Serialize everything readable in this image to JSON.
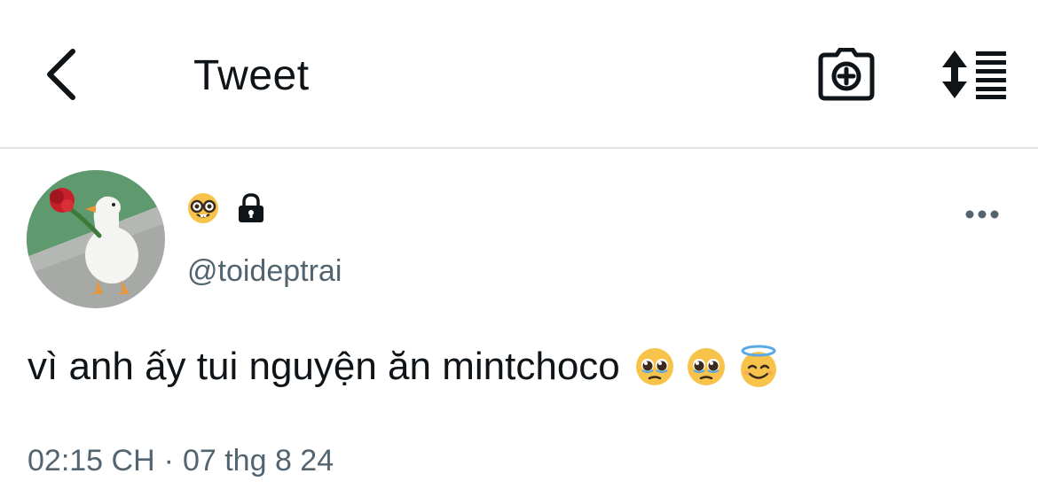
{
  "header": {
    "back_icon": "chevron-left-icon",
    "title": "Tweet",
    "camera_icon": "camera-plus-icon",
    "sort_icon": "sort-lines-icon"
  },
  "tweet": {
    "avatar_description_icon": "goose-with-rose-avatar",
    "name_emoji": "🤓",
    "lock_icon": "lock-icon",
    "handle": "@toideptrai",
    "more_icon": "more-dots-icon",
    "text": "vì anh ấy tui nguyện ăn mintchoco",
    "text_emojis": [
      "🥹",
      "🥹",
      "😇"
    ],
    "time": "02:15 CH",
    "separator": "·",
    "date": "07 thg 8 24"
  },
  "colors": {
    "text_primary": "#0f1419",
    "text_secondary": "#536471",
    "divider": "#e1e4e6",
    "background": "#ffffff"
  }
}
